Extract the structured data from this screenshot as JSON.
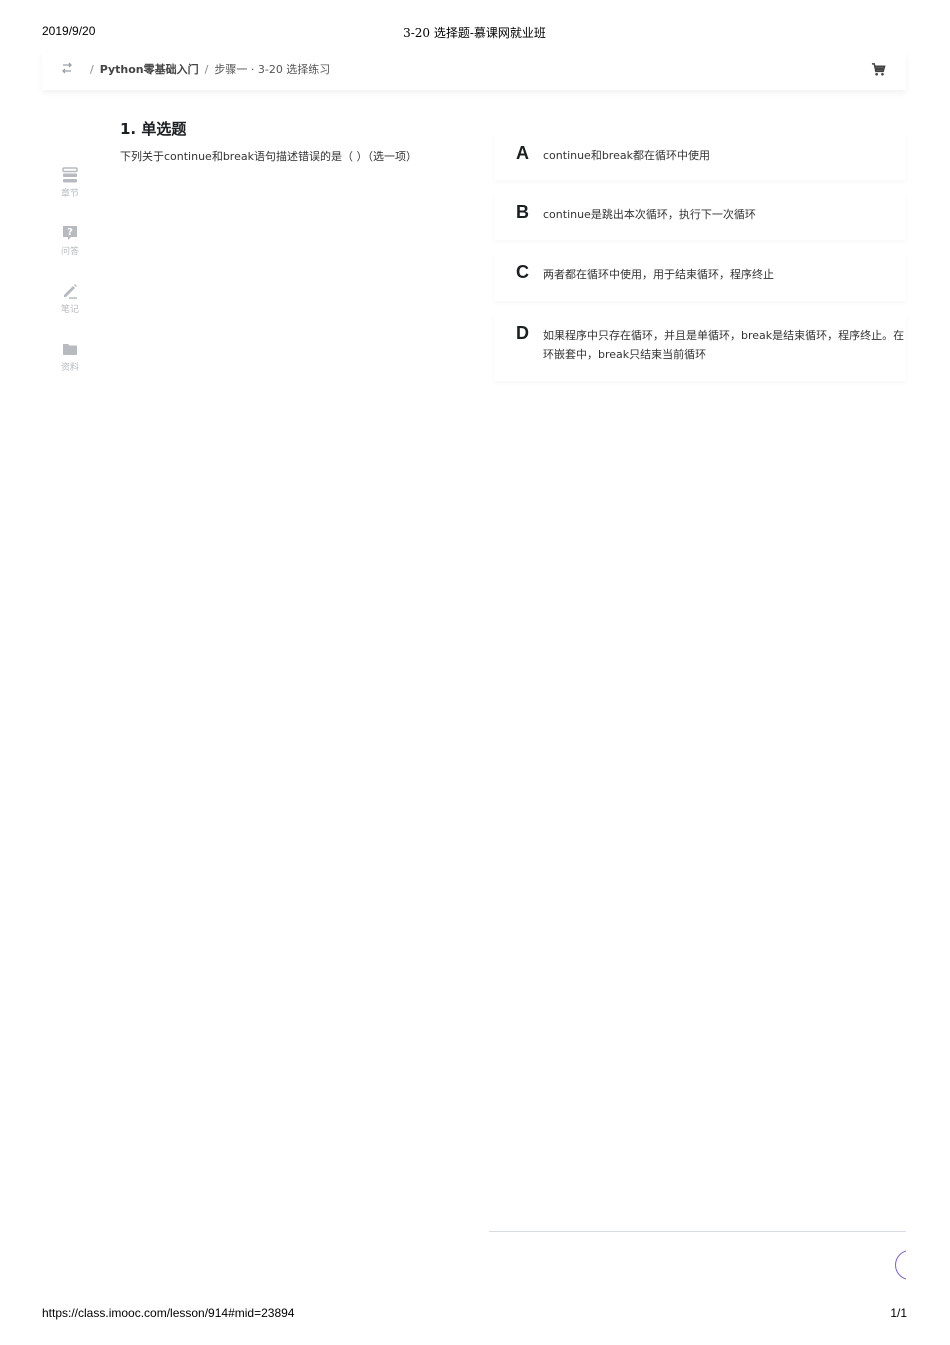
{
  "print_header": {
    "date": "2019/9/20",
    "title": "3-20 选择题-慕课网就业班"
  },
  "print_footer": {
    "url": "https://class.imooc.com/lesson/914#mid=23894",
    "page": "1/1"
  },
  "topbar": {
    "back_icon": "switch-arrows-icon",
    "breadcrumb": {
      "separator": "/",
      "course": "Python零基础入门",
      "lesson": "步骤一 · 3-20 选择练习"
    },
    "cart_icon": "shopping-cart-icon"
  },
  "sidebar": {
    "items": [
      {
        "icon": "chapter-list-icon",
        "label": "章节"
      },
      {
        "icon": "question-icon",
        "label": "问答"
      },
      {
        "icon": "pencil-icon",
        "label": "笔记"
      },
      {
        "icon": "folder-icon",
        "label": "资料"
      }
    ]
  },
  "question": {
    "title": "1. 单选题",
    "text": "下列关于continue和break语句描述错误的是（ ）（选一项）"
  },
  "options": [
    {
      "letter": "A",
      "text": "continue和break都在循环中使用"
    },
    {
      "letter": "B",
      "text": "continue是跳出本次循环，执行下一次循环"
    },
    {
      "letter": "C",
      "text": "两者都在循环中使用，用于结束循环，程序终止"
    },
    {
      "letter": "D",
      "text_line1": "如果程序中只存在循环，并且是单循环，break是结束循环，程序终止。在",
      "text_line2": "环嵌套中，break只结束当前循环"
    }
  ],
  "colors": {
    "text": "#1c1f21",
    "sidebar_icon": "#b7bbbf",
    "accent": "#7b61c9"
  }
}
